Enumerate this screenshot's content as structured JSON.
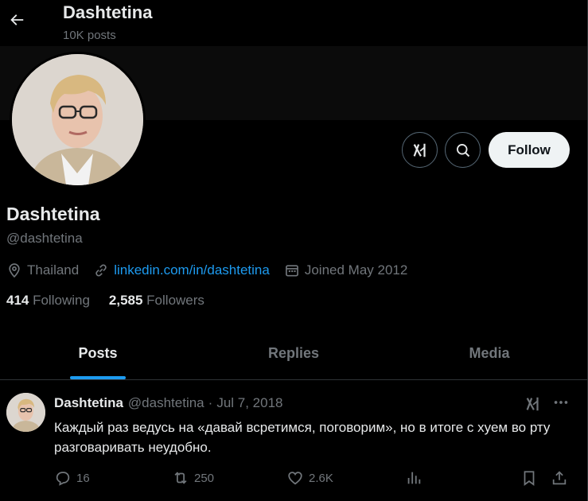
{
  "header": {
    "title": "Dashtetina",
    "post_count": "10K posts",
    "back_icon": "arrow-left-icon"
  },
  "profile": {
    "name": "Dashtetina",
    "handle": "@dashtetina",
    "location": "Thailand",
    "website": "linkedin.com/in/dashtetina",
    "joined": "Joined May 2012",
    "following_count": "414",
    "following_label": "Following",
    "followers_count": "2,585",
    "followers_label": "Followers",
    "follow_button": "Follow"
  },
  "tabs": [
    {
      "label": "Posts",
      "active": true
    },
    {
      "label": "Replies",
      "active": false
    },
    {
      "label": "Media",
      "active": false
    }
  ],
  "tweet": {
    "name": "Dashtetina",
    "handle": "@dashtetina",
    "separator": "·",
    "date": "Jul 7, 2018",
    "text": "Каждый раз ведусь на «давай всретимся, поговорим», но в итоге с хуем во рту разговаривать неудобно.",
    "replies": "16",
    "reposts": "250",
    "likes": "2.6K"
  },
  "colors": {
    "background": "#000000",
    "accent": "#1d9bf0",
    "text_primary": "#e7e9ea",
    "text_secondary": "#71767b",
    "follow_button_bg": "#eff3f4"
  }
}
